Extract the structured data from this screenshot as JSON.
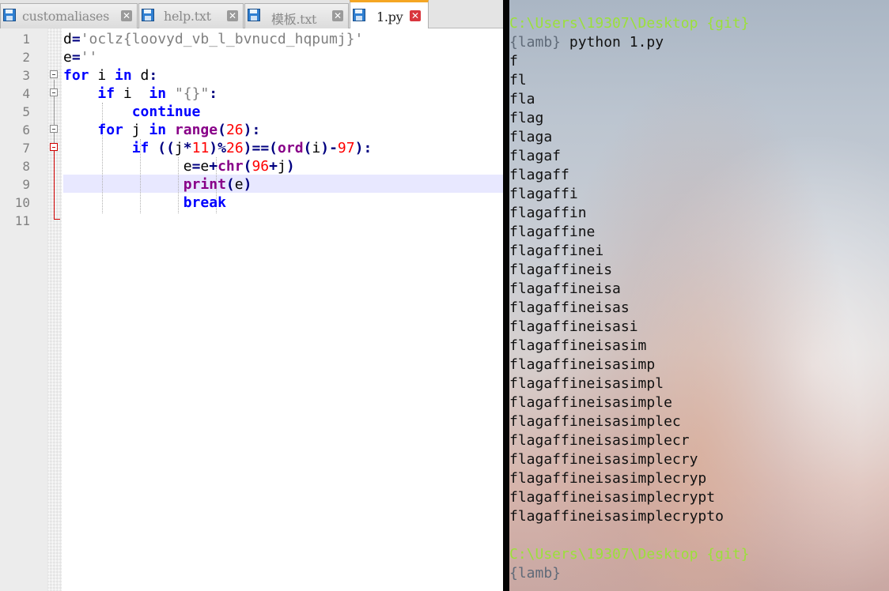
{
  "editor": {
    "tabs": [
      {
        "label": "customaliases",
        "active": false
      },
      {
        "label": "help.txt",
        "active": false
      },
      {
        "label": "模板.txt",
        "active": false
      },
      {
        "label": "1.py",
        "active": true
      }
    ],
    "line_numbers": [
      "1",
      "2",
      "3",
      "4",
      "5",
      "6",
      "7",
      "8",
      "9",
      "10",
      "11"
    ],
    "code_lines": [
      "d='oclz{loovyd_vb_l_bvnucd_hqpumj}'",
      "e=''",
      "for i in d:",
      "    if i  in \"{}\":",
      "        continue",
      "    for j in range(26):",
      "        if ((j*11)%26)==(ord(i)-97):",
      "              e=e+chr(96+j)",
      "              print(e)",
      "              break",
      ""
    ],
    "current_line": 9
  },
  "terminal": {
    "prompt_path": "C:\\Users\\19307\\Desktop {git}",
    "prompt_user": "{lamb}",
    "command": " python 1.py",
    "output": [
      "f",
      "fl",
      "fla",
      "flag",
      "flaga",
      "flagaf",
      "flagaff",
      "flagaffi",
      "flagaffin",
      "flagaffine",
      "flagaffinei",
      "flagaffineis",
      "flagaffineisa",
      "flagaffineisas",
      "flagaffineisasi",
      "flagaffineisasim",
      "flagaffineisasimp",
      "flagaffineisasimpl",
      "flagaffineisasimple",
      "flagaffineisasimplec",
      "flagaffineisasimplecr",
      "flagaffineisasimplecry",
      "flagaffineisasimplecryp",
      "flagaffineisasimplecrypt",
      "flagaffineisasimplecrypto"
    ],
    "prompt_path_2": "C:\\Users\\19307\\Desktop {git}",
    "prompt_user_2": "{lamb}"
  },
  "colors": {
    "keyword": "#0000ff",
    "builtin": "#880088",
    "string": "#808080",
    "number": "#ff0000",
    "prompt_green": "#9be03a",
    "active_tab_accent": "#f5a623"
  },
  "icons": {
    "tab_file_icon": "save-disk-icon",
    "tab_close_icon": "close-x-icon",
    "fold_icon": "fold-minus-icon"
  }
}
